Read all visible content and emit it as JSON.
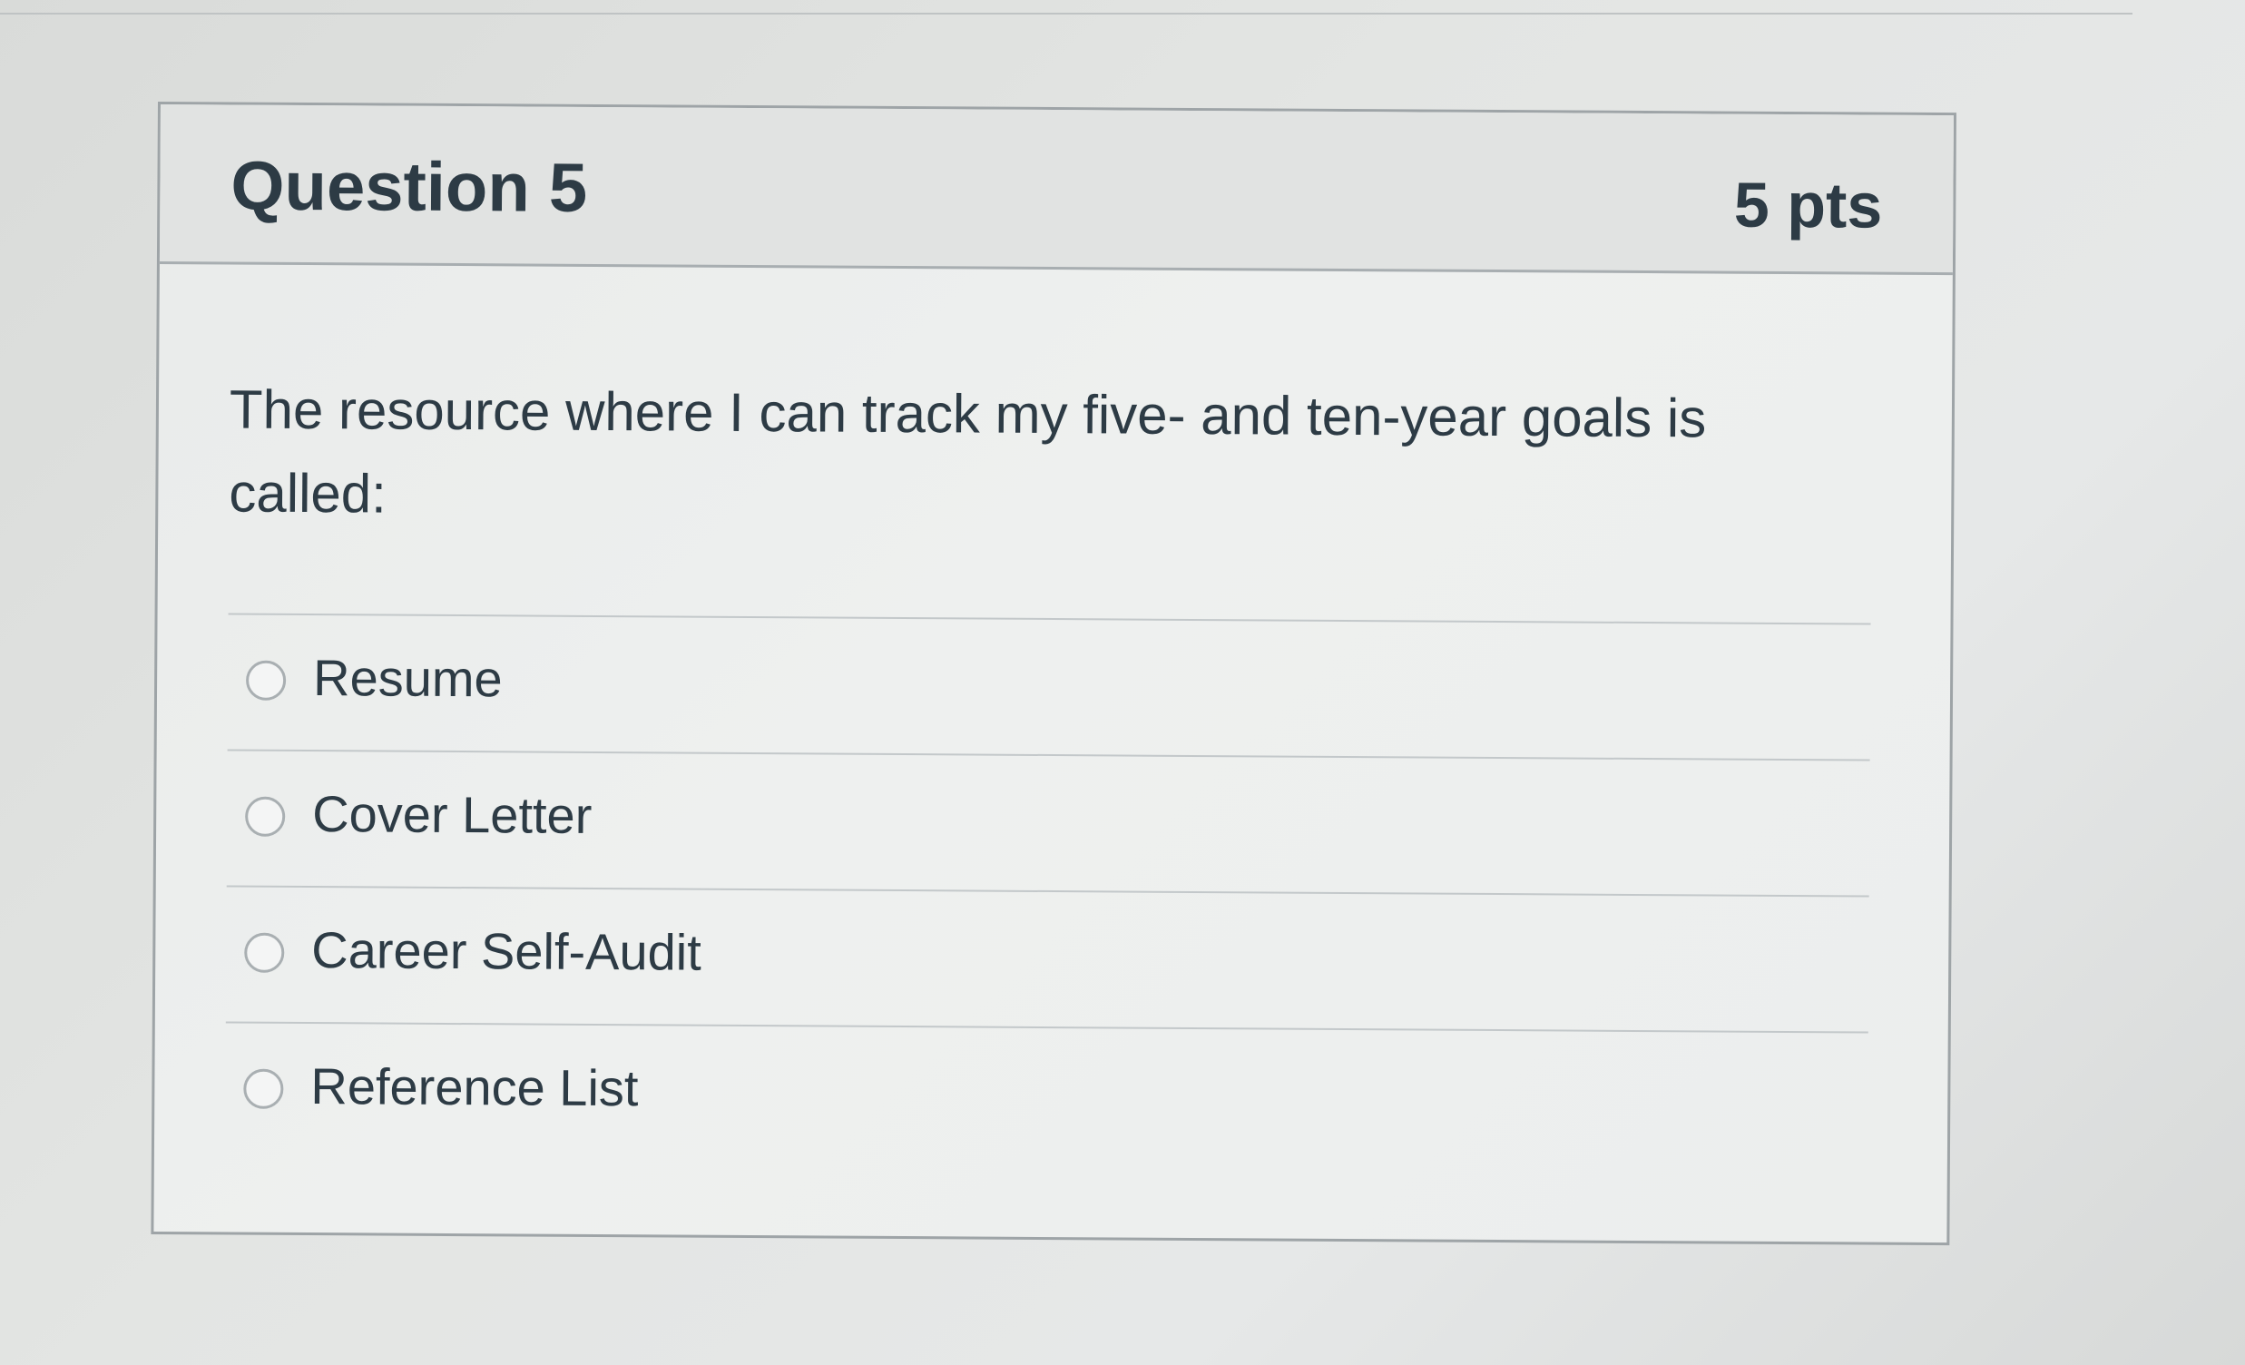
{
  "question": {
    "title": "Question 5",
    "points": "5 pts",
    "text": "The resource where I can track my five- and ten-year goals is called:"
  },
  "answers": [
    {
      "label": "Resume",
      "selected": false
    },
    {
      "label": "Cover Letter",
      "selected": false
    },
    {
      "label": "Career Self-Audit",
      "selected": false
    },
    {
      "label": "Reference List",
      "selected": false
    }
  ],
  "colors": {
    "text": "#2d3b45",
    "border": "#9ea4a7",
    "header_bg": "#e1e3e2"
  }
}
